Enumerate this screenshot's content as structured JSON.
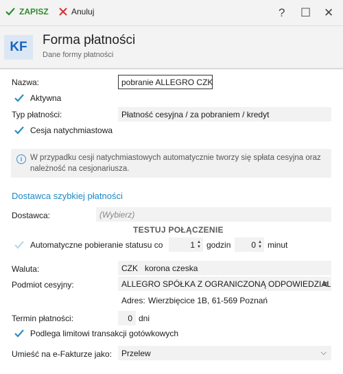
{
  "toolbar": {
    "save_label": "ZAPISZ",
    "cancel_label": "Anuluj"
  },
  "window": {
    "help": "?",
    "maximize": "☐",
    "close": "✕"
  },
  "header": {
    "badge": "KF",
    "title": "Forma płatności",
    "subtitle": "Dane formy płatności"
  },
  "form": {
    "name_label": "Nazwa:",
    "name_value": "pobranie ALLEGRO CZK",
    "active_label": "Aktywna",
    "payment_type_label": "Typ płatności:",
    "payment_type_value": "Płatność cesyjna / za pobraniem / kredyt",
    "instant_cession_label": "Cesja natychmiastowa",
    "info_text": "W przypadku cesji natychmiastowych automatycznie tworzy się spłata cesyjna oraz należność na cesjonariusza.",
    "fast_payment_section": "Dostawca szybkiej płatności",
    "provider_label": "Dostawca:",
    "provider_placeholder": "(Wybierz)",
    "test_connection": "TESTUJ POŁĄCZENIE",
    "auto_status_label": "Automatyczne pobieranie statusu co",
    "hours_value": "1",
    "hours_label": "godzin",
    "minutes_value": "0",
    "minutes_label": "minut",
    "currency_label": "Waluta:",
    "currency_code": "CZK",
    "currency_name": "korona czeska",
    "cession_subject_label": "Podmiot cesyjny:",
    "cession_subject_value": "ALLEGRO SPÓŁKA Z OGRANICZONĄ ODPOWIEDZIALNOŚCIĄ",
    "address_label": "Adres:",
    "address_value": "Wierzbięcice 1B, 61-569 Poznań",
    "payment_term_label": "Termin płatności:",
    "payment_term_value": "0",
    "payment_term_unit": "dni",
    "cash_limit_label": "Podlega limitowi transakcji gotówkowych",
    "efaktura_label": "Umieść na e-Fakturze jako:",
    "efaktura_value": "Przelew"
  },
  "colors": {
    "accent": "#1e88c7",
    "check": "#2e8bc0",
    "save": "#2e8b2e",
    "cancel": "#d32f2f"
  }
}
